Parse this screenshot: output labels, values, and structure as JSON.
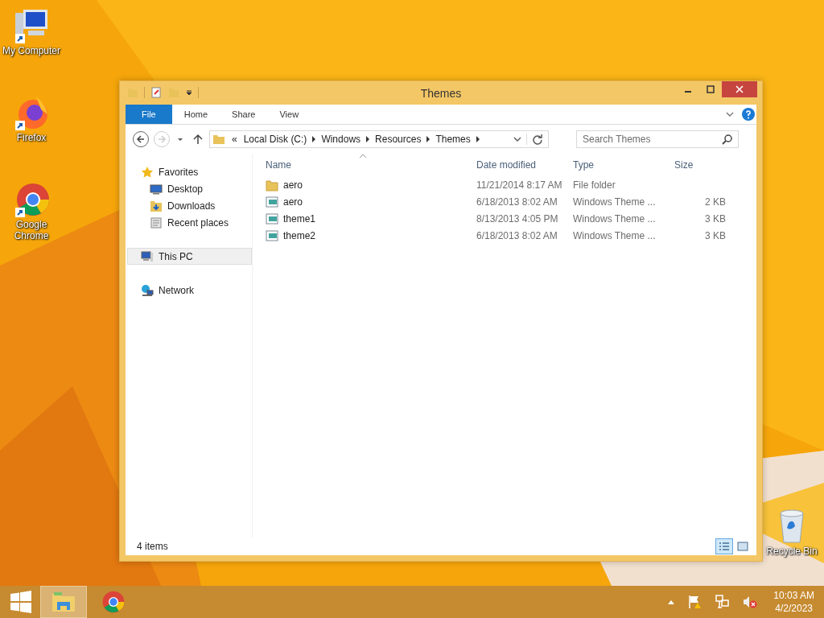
{
  "desktop_icons": [
    {
      "label": "My Computer",
      "kind": "computer"
    },
    {
      "label": "Firefox",
      "kind": "firefox"
    },
    {
      "label": "Google Chrome",
      "kind": "chrome"
    },
    {
      "label": "Recycle Bin",
      "kind": "recycle"
    }
  ],
  "window": {
    "title": "Themes",
    "ribbon_tabs": [
      {
        "label": "File",
        "kind": "file",
        "selected": false
      },
      {
        "label": "Home",
        "kind": "tab",
        "selected": false
      },
      {
        "label": "Share",
        "kind": "tab",
        "selected": false
      },
      {
        "label": "View",
        "kind": "tab",
        "selected": false
      }
    ],
    "address": {
      "overflow": "«",
      "crumbs": [
        "Local Disk (C:)",
        "Windows",
        "Resources",
        "Themes"
      ]
    },
    "search": {
      "placeholder": "Search Themes"
    },
    "nav": [
      {
        "label": "Favorites",
        "kind": "star",
        "selected": false,
        "children": [
          {
            "label": "Desktop",
            "kind": "desktop",
            "selected": false
          },
          {
            "label": "Downloads",
            "kind": "downloads",
            "selected": false
          },
          {
            "label": "Recent places",
            "kind": "recent",
            "selected": false
          }
        ]
      },
      {
        "label": "This PC",
        "kind": "pc",
        "selected": true
      },
      {
        "label": "Network",
        "kind": "network",
        "selected": false
      }
    ],
    "columns": [
      "Name",
      "Date modified",
      "Type",
      "Size"
    ],
    "rows": [
      {
        "name": "aero",
        "kind": "folder",
        "date": "11/21/2014 8:17 AM",
        "type": "File folder"
      },
      {
        "name": "aero",
        "kind": "theme",
        "date": "6/18/2013 8:02 AM",
        "type": "Windows Theme ...",
        "size": "2 KB"
      },
      {
        "name": "theme1",
        "kind": "theme",
        "date": "8/13/2013 4:05 PM",
        "type": "Windows Theme ...",
        "size": "3 KB"
      },
      {
        "name": "theme2",
        "kind": "theme",
        "date": "6/18/2013 8:02 AM",
        "type": "Windows Theme ...",
        "size": "3 KB"
      }
    ],
    "status": "4 items",
    "views": [
      {
        "kind": "details",
        "selected": true
      },
      {
        "kind": "large",
        "selected": false
      }
    ]
  },
  "taskbar": {
    "apps": [
      {
        "kind": "explorer",
        "selected": true
      },
      {
        "kind": "chrome",
        "selected": false
      }
    ],
    "time": "10:03 AM",
    "date": "4/2/2023"
  }
}
